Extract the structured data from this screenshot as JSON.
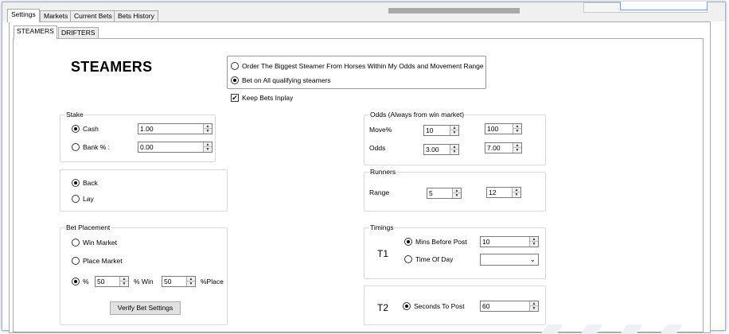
{
  "tabs": [
    "Settings",
    "Markets",
    "Current Bets",
    "Bets History"
  ],
  "subtabs": [
    "STEAMERS",
    "DRIFTERS"
  ],
  "title": "STEAMERS",
  "order_mode": {
    "option1": "Order The Biggest Steamer From Horses Within My Odds and Movement Range",
    "option2": "Bet on All qualifying steamers",
    "selected": "option2"
  },
  "keep_inplay": {
    "label": "Keep Bets Inplay",
    "checked": true
  },
  "stake": {
    "legend": "Stake",
    "cash_label": "Cash",
    "cash_value": "1.00",
    "bank_label": "Bank % :",
    "bank_value": "0.00",
    "selected": "cash"
  },
  "side": {
    "back_label": "Back",
    "lay_label": "Lay",
    "selected": "back"
  },
  "placement": {
    "legend": "Bet Placement",
    "win_label": "Win Market",
    "place_label": "Place Market",
    "pct_label": "%",
    "pct_win_value": "50",
    "pct_win_label": "% Win",
    "pct_place_value": "50",
    "pct_place_label": "%Place",
    "selected": "pct",
    "verify_label": "Verify Bet Settings"
  },
  "odds": {
    "legend": "Odds (Always from win market)",
    "move_label": "Move%",
    "move_min": "10",
    "move_max": "100",
    "odds_label": "Odds",
    "odds_min": "3.00",
    "odds_max": "7.00"
  },
  "runners": {
    "legend": "Runners",
    "range_label": "Range",
    "min": "5",
    "max": "12"
  },
  "timings": {
    "legend": "Timings",
    "t1_label": "T1",
    "mins_label": "Mins Before Post",
    "mins_value": "10",
    "tod_label": "Time Of Day",
    "tod_value": "",
    "selected": "mins",
    "t2_label": "T2",
    "secs_label": "Seconds To Post",
    "secs_value": "60"
  }
}
